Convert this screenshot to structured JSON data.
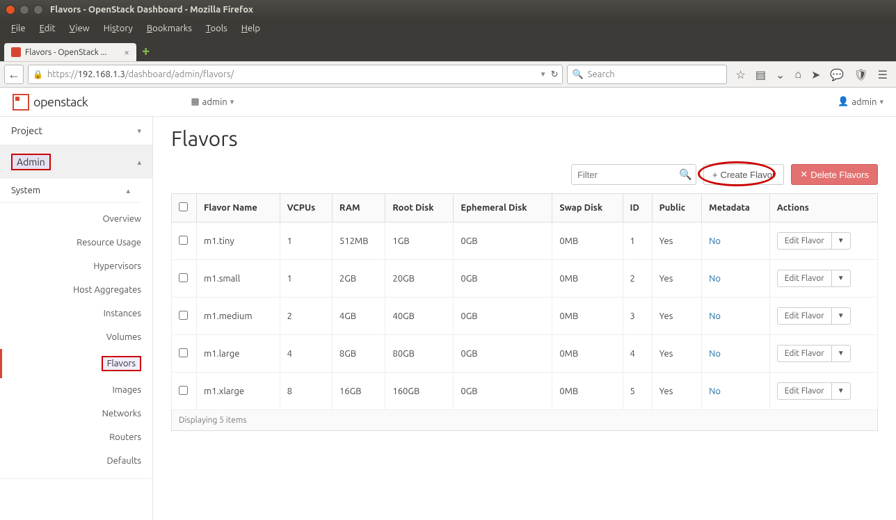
{
  "window": {
    "title": "Flavors - OpenStack Dashboard - Mozilla Firefox"
  },
  "menu": {
    "file": "File",
    "edit": "Edit",
    "view": "View",
    "history": "History",
    "bookmarks": "Bookmarks",
    "tools": "Tools",
    "help": "Help"
  },
  "tab": {
    "label": "Flavors - OpenStack ..."
  },
  "url": {
    "prefix": "https://",
    "host": "192.168.1.3",
    "path": "/dashboard/admin/flavors/"
  },
  "search": {
    "placeholder": "Search"
  },
  "dash": {
    "logo": "openstack",
    "project_selector": "admin",
    "user_selector": "admin"
  },
  "sidebar": {
    "project": "Project",
    "admin": "Admin",
    "system": "System",
    "items": [
      "Overview",
      "Resource Usage",
      "Hypervisors",
      "Host Aggregates",
      "Instances",
      "Volumes",
      "Flavors",
      "Images",
      "Networks",
      "Routers",
      "Defaults"
    ]
  },
  "page": {
    "title": "Flavors",
    "filter_placeholder": "Filter",
    "create_label": "Create Flavor",
    "delete_label": "Delete Flavors",
    "footer": "Displaying 5 items"
  },
  "table": {
    "headers": [
      "Flavor Name",
      "VCPUs",
      "RAM",
      "Root Disk",
      "Ephemeral Disk",
      "Swap Disk",
      "ID",
      "Public",
      "Metadata",
      "Actions"
    ],
    "edit_label": "Edit Flavor",
    "rows": [
      {
        "name": "m1.tiny",
        "vcpus": "1",
        "ram": "512MB",
        "root": "1GB",
        "eph": "0GB",
        "swap": "0MB",
        "id": "1",
        "public": "Yes",
        "meta": "No"
      },
      {
        "name": "m1.small",
        "vcpus": "1",
        "ram": "2GB",
        "root": "20GB",
        "eph": "0GB",
        "swap": "0MB",
        "id": "2",
        "public": "Yes",
        "meta": "No"
      },
      {
        "name": "m1.medium",
        "vcpus": "2",
        "ram": "4GB",
        "root": "40GB",
        "eph": "0GB",
        "swap": "0MB",
        "id": "3",
        "public": "Yes",
        "meta": "No"
      },
      {
        "name": "m1.large",
        "vcpus": "4",
        "ram": "8GB",
        "root": "80GB",
        "eph": "0GB",
        "swap": "0MB",
        "id": "4",
        "public": "Yes",
        "meta": "No"
      },
      {
        "name": "m1.xlarge",
        "vcpus": "8",
        "ram": "16GB",
        "root": "160GB",
        "eph": "0GB",
        "swap": "0MB",
        "id": "5",
        "public": "Yes",
        "meta": "No"
      }
    ]
  }
}
